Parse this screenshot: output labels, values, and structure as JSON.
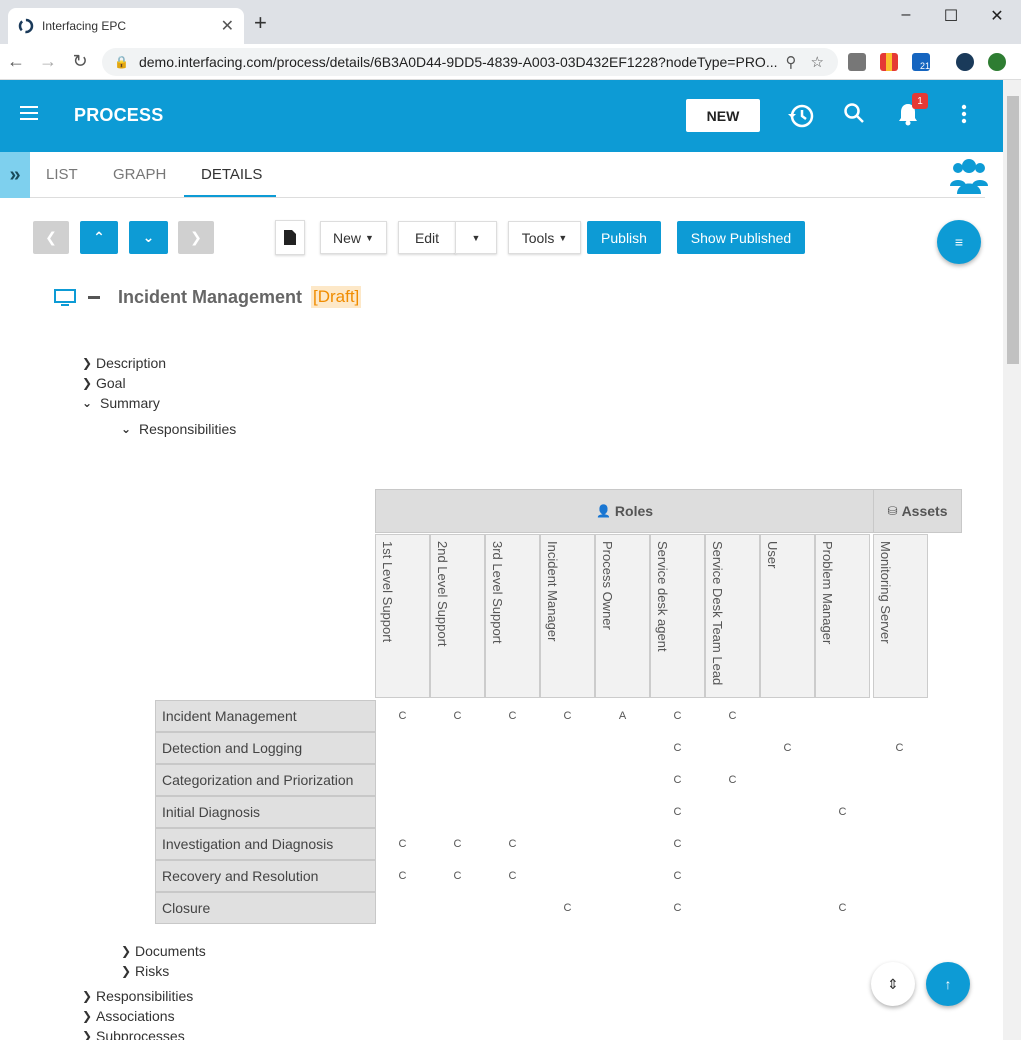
{
  "browser": {
    "tab_title": "Interfacing EPC",
    "url": "demo.interfacing.com/process/details/6B3A0D44-9DD5-4839-A003-03D432EF1228?nodeType=PRO...",
    "ext_badge": "21"
  },
  "header": {
    "title": "PROCESS",
    "new_label": "NEW",
    "notif_count": "1"
  },
  "tabs": [
    "LIST",
    "GRAPH",
    "DETAILS"
  ],
  "toolbar": {
    "new_label": "New",
    "edit_label": "Edit",
    "tools_label": "Tools",
    "publish_label": "Publish",
    "show_published_label": "Show Published"
  },
  "process": {
    "title": "Incident Management",
    "status": "[Draft]"
  },
  "tree": {
    "description": "Description",
    "goal": "Goal",
    "summary": "Summary",
    "responsibilities_sub": "Responsibilities",
    "documents": "Documents",
    "risks": "Risks",
    "responsibilities": "Responsibilities",
    "associations": "Associations",
    "subprocesses": "Subprocesses"
  },
  "matrix": {
    "roles_label": "Roles",
    "assets_label": "Assets",
    "columns": [
      "1st Level Support",
      "2nd Level Support",
      "3rd Level Support",
      "Incident Manager",
      "Process Owner",
      "Service desk agent",
      "Service Desk Team Lead",
      "User",
      "Problem Manager",
      "Monitoring Server"
    ],
    "rows": [
      {
        "name": "Incident Management",
        "cells": [
          "C",
          "C",
          "C",
          "C",
          "A",
          "C",
          "C",
          "",
          "",
          ""
        ]
      },
      {
        "name": "Detection and Logging",
        "cells": [
          "",
          "",
          "",
          "",
          "",
          "C",
          "",
          "C",
          "",
          "C"
        ]
      },
      {
        "name": "Categorization and Priorization",
        "cells": [
          "",
          "",
          "",
          "",
          "",
          "C",
          "C",
          "",
          "",
          ""
        ]
      },
      {
        "name": "Initial Diagnosis",
        "cells": [
          "",
          "",
          "",
          "",
          "",
          "C",
          "",
          "",
          "C",
          ""
        ]
      },
      {
        "name": "Investigation and Diagnosis",
        "cells": [
          "C",
          "C",
          "C",
          "",
          "",
          "C",
          "",
          "",
          "",
          ""
        ]
      },
      {
        "name": "Recovery and Resolution",
        "cells": [
          "C",
          "C",
          "C",
          "",
          "",
          "C",
          "",
          "",
          "",
          ""
        ]
      },
      {
        "name": "Closure",
        "cells": [
          "",
          "",
          "",
          "C",
          "",
          "C",
          "",
          "",
          "C",
          ""
        ]
      }
    ]
  }
}
